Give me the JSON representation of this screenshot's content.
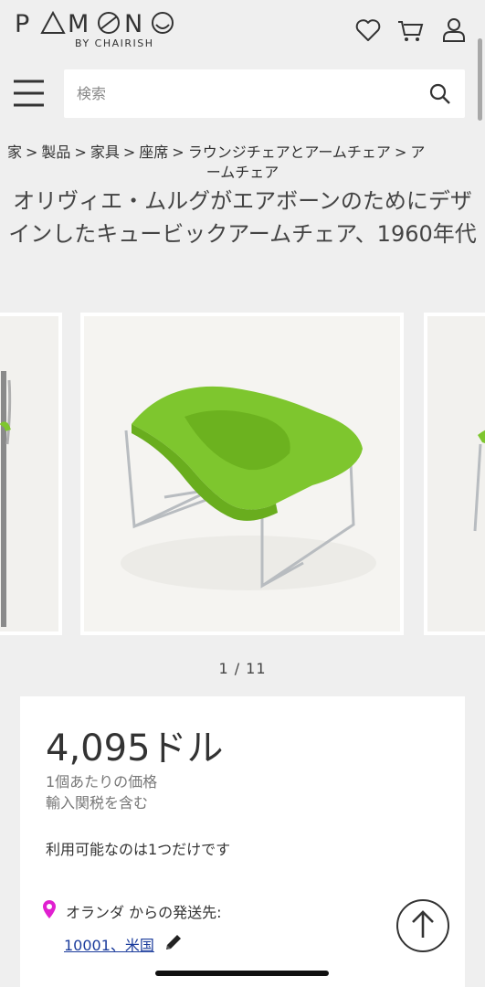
{
  "header": {
    "logo_text": "PAMONO",
    "logo_sub": "BY CHAIRISH",
    "icons": [
      "heart-icon",
      "cart-icon",
      "user-icon",
      "menu-icon",
      "search-icon"
    ],
    "search_placeholder": "検索"
  },
  "breadcrumb": {
    "items": [
      "家",
      "製品",
      "家具",
      "座席",
      "ラウンジチェアとアームチェア",
      "アームチェア"
    ],
    "separator": ">",
    "line2": "ームチェア"
  },
  "product": {
    "title": "オリヴィエ・ムルグがエアボーンのためにデザインしたキュービックアームチェア、1960年代",
    "image_counter": "1 / 11"
  },
  "pricing": {
    "price": "4,095ドル",
    "unit_line1": "1個あたりの価格",
    "unit_line2": "輸入関税を含む",
    "availability": "利用可能なのは1つだけです",
    "ship_from": "オランダ からの発送先:",
    "ship_to": "10001、米国"
  },
  "colors": {
    "background": "#efefef",
    "chair_green": "#7ec62e",
    "link_blue": "#1b3c9c",
    "pin_magenta": "#e020d0"
  }
}
